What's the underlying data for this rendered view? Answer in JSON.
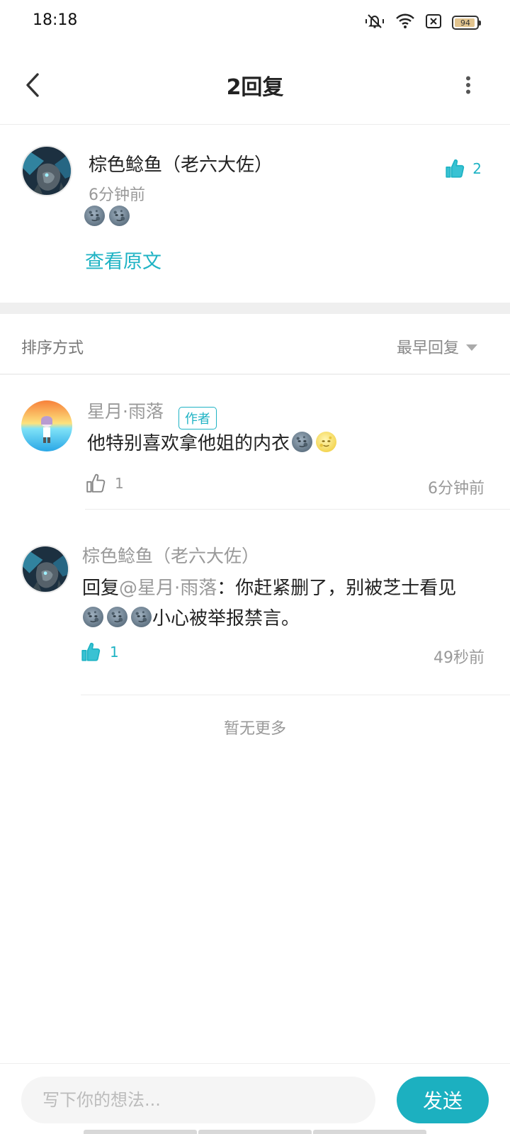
{
  "status_bar": {
    "time": "18:18",
    "battery_level": "94",
    "battery_fraction": 0.94
  },
  "header": {
    "title": "2回复"
  },
  "main_comment": {
    "author": "棕色鲶鱼（老六大佐）",
    "time": "6分钟前",
    "emojis": [
      "new-moon-face",
      "new-moon-face"
    ],
    "likes": "2",
    "view_original": "查看原文"
  },
  "sort": {
    "label": "排序方式",
    "value": "最早回复"
  },
  "replies": [
    {
      "author": "星月·雨落",
      "badge": "作者",
      "text": "他特别喜欢拿他姐的内衣",
      "emojis": [
        "new-moon-face",
        "full-moon-face"
      ],
      "likes": "1",
      "liked": false,
      "time": "6分钟前"
    },
    {
      "author": "棕色鲶鱼（老六大佐）",
      "prefix": "回复",
      "mention": "@星月·雨落",
      "text_line1": "：你赶紧删了，别被芝士看见",
      "text_line2": "小心被举报禁言。",
      "emojis": [
        "new-moon-face",
        "new-moon-face",
        "new-moon-face"
      ],
      "likes": "1",
      "liked": true,
      "time": "49秒前"
    }
  ],
  "footer_text": "暂无更多",
  "input": {
    "placeholder": "写下你的想法...",
    "send_label": "发送"
  },
  "colors": {
    "accent": "#1fb3c4",
    "muted_text": "#999999",
    "divider": "#efefef"
  }
}
